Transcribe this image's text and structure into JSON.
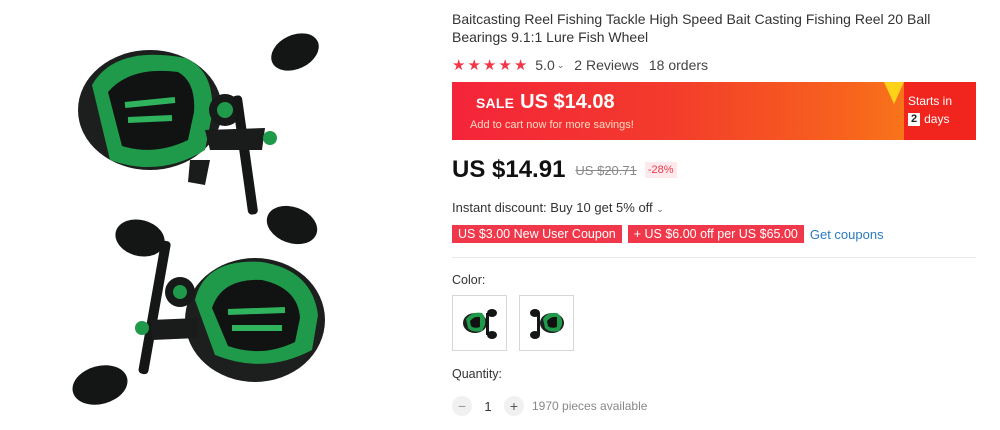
{
  "product": {
    "title": "Baitcasting Reel Fishing Tackle High Speed Bait Casting Fishing Reel 20 Ball Bearings 9.1:1 Lure Fish Wheel",
    "image_icon": "fishing-reel-image",
    "rating": {
      "stars": 5,
      "value": "5.0",
      "reviews": "2 Reviews",
      "orders": "18 orders",
      "star_color": "#f0384a"
    },
    "sale": {
      "tag": "SALE",
      "price": "US $14.08",
      "subtitle": "Add to cart now for more savings!",
      "starts_in": "Starts in",
      "days_number": "2",
      "days_word": "days"
    },
    "price": {
      "current": "US $14.91",
      "original": "US $20.71",
      "discount": "-28%"
    },
    "instant_discount": "Instant discount: Buy 10 get 5% off",
    "coupons": [
      "US $3.00 New User Coupon",
      "+ US $6.00 off per US $65.00"
    ],
    "get_coupons": "Get coupons",
    "color_label": "Color:",
    "colors": [
      "green-reel-right",
      "green-reel-left"
    ],
    "quantity_label": "Quantity:",
    "quantity": "1",
    "available": "1970 pieces available",
    "accent_color": "#f0384a",
    "link_color": "#2a7ac0"
  }
}
